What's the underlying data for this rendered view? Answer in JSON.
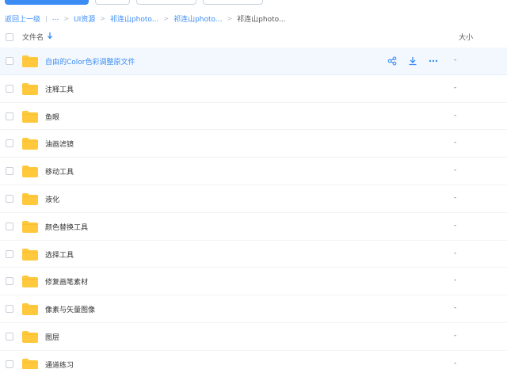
{
  "breadcrumb": {
    "back": "返回上一级",
    "ellipsis": "...",
    "items": [
      "UI资源",
      "祁连山photo...",
      "祁连山photo..."
    ],
    "current": "祁连山photo..."
  },
  "header": {
    "name_label": "文件名",
    "size_label": "大小"
  },
  "rows": [
    {
      "name": "自由的Color色彩调整原文件",
      "size": "-"
    },
    {
      "name": "注释工具",
      "size": "-"
    },
    {
      "name": "鱼眼",
      "size": "-"
    },
    {
      "name": "油画滤镜",
      "size": "-"
    },
    {
      "name": "移动工具",
      "size": "-"
    },
    {
      "name": "液化",
      "size": "-"
    },
    {
      "name": "颜色替换工具",
      "size": "-"
    },
    {
      "name": "选择工具",
      "size": "-"
    },
    {
      "name": "修复画笔素材",
      "size": "-"
    },
    {
      "name": "像素与矢量图像",
      "size": "-"
    },
    {
      "name": "图层",
      "size": "-"
    },
    {
      "name": "通道练习",
      "size": "-"
    }
  ],
  "row_actions": [
    "share-icon",
    "download-icon",
    "more-icon"
  ],
  "colors": {
    "accent": "#3b8cf5",
    "folder": "#ffc83d",
    "hover_row": "#f3f8fe"
  }
}
